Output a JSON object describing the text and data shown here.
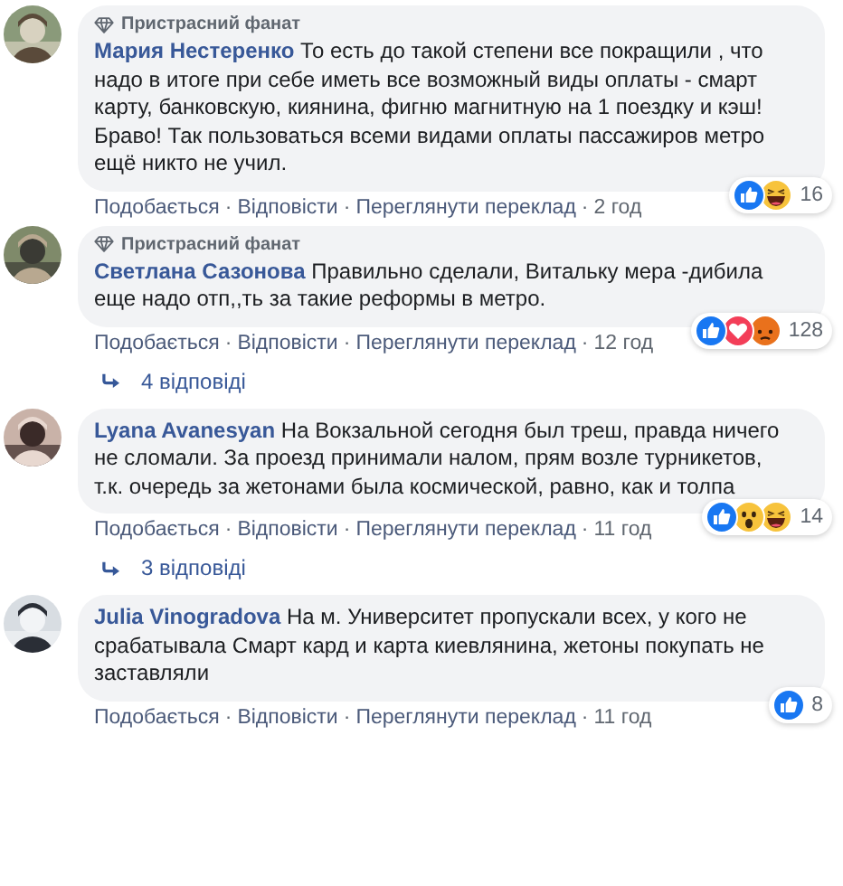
{
  "separator": "·",
  "comments": [
    {
      "badge": "Пристрасний фанат",
      "author": "Мария Нестеренко",
      "text": "То есть до такой степени все покращили , что надо в итоге при себе иметь все возможный виды оплаты - смарт карту, банковскую, киянина, фигню магнитную на 1 поездку и кэш!\nБраво! Так пользоваться всеми видами оплаты пассажиров метро ещё никто не учил.",
      "reactions": [
        {
          "kind": "like"
        },
        {
          "kind": "haha"
        }
      ],
      "reaction_count": "16",
      "actions": [
        "Подобається",
        "Відповісти",
        "Переглянути переклад"
      ],
      "time": "2 год"
    },
    {
      "badge": "Пристрасний фанат",
      "author": "Светлана Сазонова",
      "text": "Правильно сделали, Витальку мера -дибила еще надо отп,,ть за такие реформы в метро.",
      "reactions": [
        {
          "kind": "like"
        },
        {
          "kind": "love"
        },
        {
          "kind": "angry"
        }
      ],
      "reaction_count": "128",
      "actions": [
        "Подобається",
        "Відповісти",
        "Переглянути переклад"
      ],
      "time": "12 год",
      "replies": "4 відповіді"
    },
    {
      "author": "Lyana Avanesyan",
      "text": "На Вокзальной сегодня был треш, правда ничего не сломали. За проезд принимали налом, прям возле турникетов, т.к. очередь за жетонами была космической, равно, как и толпа",
      "reactions": [
        {
          "kind": "like"
        },
        {
          "kind": "wow"
        },
        {
          "kind": "haha"
        }
      ],
      "reaction_count": "14",
      "actions": [
        "Подобається",
        "Відповісти",
        "Переглянути переклад"
      ],
      "time": "11 год",
      "replies": "3 відповіді"
    },
    {
      "author": "Julia Vinogradova",
      "text": "На м. Университет пропускали всех, у кого не срабатывала Смарт кард и карта киевлянина, жетоны покупать не заставляли",
      "reactions": [
        {
          "kind": "like"
        }
      ],
      "reaction_count": "8",
      "actions": [
        "Подобається",
        "Відповісти",
        "Переглянути переклад"
      ],
      "time": "11 год"
    }
  ]
}
